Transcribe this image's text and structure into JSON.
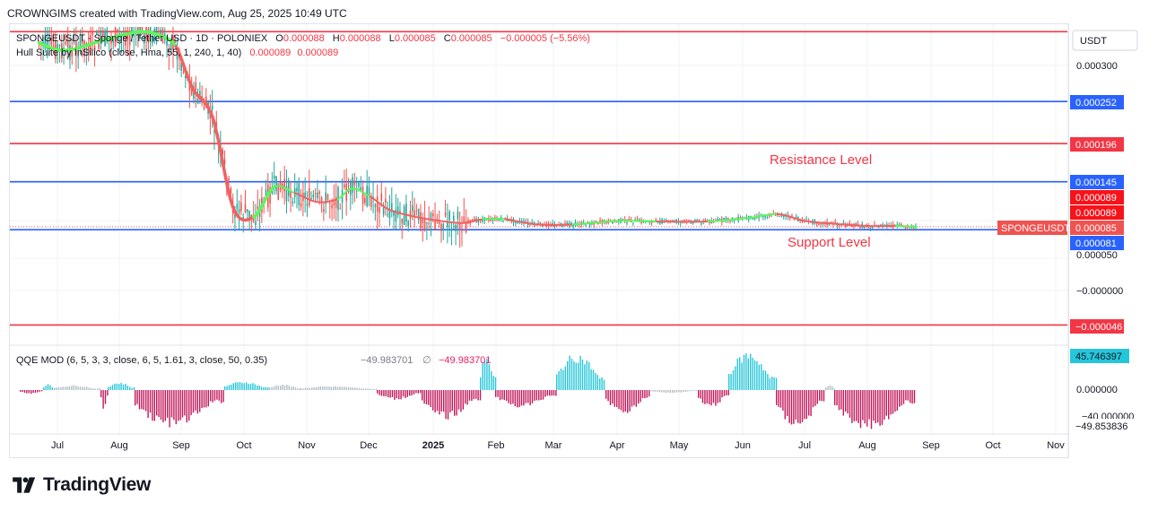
{
  "header": {
    "text": "CROWNGIMS created with TradingView.com, Aug 25, 2025 10:49 UTC"
  },
  "legend": {
    "symbol_line": "SPONGEUSDT · Sponge / Tether USD · 1D · POLONIEX",
    "o_label": "O",
    "o_value": "0.000088",
    "h_label": "H",
    "h_value": "0.000088",
    "l_label": "L",
    "l_value": "0.000085",
    "c_label": "C",
    "c_value": "0.000085",
    "change": "−0.000005 (−5.56%)",
    "hull_label": "Hull Suite by InSilico (close, Hma, 55, 1, 240, 1, 40)",
    "hull_v1": "0.000089",
    "hull_v2": "0.000089",
    "qqe_label": "QQE MOD (6, 5, 3, 3, close, 6, 5, 1.61, 3, close, 50, 0.35)",
    "qqe_v1": "−49.983701",
    "qqe_null": "∅",
    "qqe_v2": "−49.983701"
  },
  "annotations": {
    "resistance": "Resistance Level",
    "support": "Support Level"
  },
  "price_axis": {
    "currency": "USDT",
    "ticks": [
      "0.000300",
      "0.000050",
      "−0.000000"
    ]
  },
  "price_tags": [
    {
      "value": "0.000252",
      "color": "#2962ff"
    },
    {
      "value": "0.000196",
      "color": "#f23645"
    },
    {
      "value": "0.000145",
      "color": "#2962ff"
    },
    {
      "value": "0.000089",
      "color": "#f7131b"
    },
    {
      "value": "0.000089",
      "color": "#f7131b"
    },
    {
      "value": "0.000085",
      "color": "#ef5350"
    },
    {
      "value": "0.000081",
      "color": "#2962ff"
    },
    {
      "value": "−0.000046",
      "color": "#f23645"
    }
  ],
  "symbol_tag": "SPONGEUSDT",
  "qqe_axis": {
    "ticks": [
      "0.000000",
      "−40.000000"
    ],
    "tags": [
      {
        "value": "45.746397",
        "color": "#26c6da"
      },
      {
        "value": "−49.853836",
        "color": "#ffffff"
      }
    ]
  },
  "time_axis": {
    "labels": [
      "Jul",
      "Aug",
      "Sep",
      "Oct",
      "Nov",
      "Dec",
      "2025",
      "Feb",
      "Mar",
      "Apr",
      "May",
      "Jun",
      "Jul",
      "Aug",
      "Sep",
      "Oct",
      "Nov"
    ]
  },
  "brand": {
    "name": "TradingView"
  },
  "chart_data": {
    "type": "candlestick",
    "symbol": "SPONGEUSDT",
    "interval": "1D",
    "exchange": "POLONIEX",
    "ylim": [
      -6e-05,
      0.00036
    ],
    "horizontal_levels": [
      {
        "value": 0.000345,
        "color": "#f23645"
      },
      {
        "value": 0.000252,
        "color": "#2962ff"
      },
      {
        "value": 0.000196,
        "color": "#f23645"
      },
      {
        "value": 0.000145,
        "color": "#2962ff"
      },
      {
        "value": 8.1e-05,
        "color": "#2962ff"
      },
      {
        "value": -4.6e-05,
        "color": "#f23645"
      }
    ],
    "hull_series": {
      "x": [
        "2024-06-22",
        "2024-07-05",
        "2024-07-25",
        "2024-08-10",
        "2024-08-20",
        "2024-08-28",
        "2024-09-05",
        "2024-09-15",
        "2024-09-25",
        "2024-10-05",
        "2024-10-15",
        "2024-10-25",
        "2024-11-05",
        "2024-11-15",
        "2024-11-22",
        "2024-12-01",
        "2024-12-10",
        "2024-12-20",
        "2025-01-01",
        "2025-01-15",
        "2025-01-25",
        "2025-02-05",
        "2025-02-20",
        "2025-03-10",
        "2025-04-01",
        "2025-04-20",
        "2025-05-15",
        "2025-06-05",
        "2025-06-18",
        "2025-07-01",
        "2025-07-15",
        "2025-08-01",
        "2025-08-15",
        "2025-08-25"
      ],
      "y": [
        0.00033,
        0.00032,
        0.000335,
        0.000345,
        0.00034,
        0.000325,
        0.00027,
        0.00023,
        0.00011,
        9.8e-05,
        0.000138,
        0.00013,
        0.000118,
        0.000122,
        0.000136,
        0.000125,
        0.000108,
        0.0001,
        9.4e-05,
        9e-05,
        9.5e-05,
        9.5e-05,
        8.8e-05,
        8.8e-05,
        9.3e-05,
        9.2e-05,
        9.2e-05,
        9.7e-05,
        0.000102,
        9.3e-05,
        8.9e-05,
        8.6e-05,
        8.6e-05,
        8.5e-05
      ],
      "trend": [
        "up",
        "up",
        "up",
        "up",
        "up",
        "down",
        "down",
        "down",
        "down",
        "up",
        "up",
        "down",
        "down",
        "up",
        "up",
        "down",
        "down",
        "down",
        "down",
        "down",
        "up",
        "down",
        "down",
        "up",
        "up",
        "down",
        "up",
        "up",
        "down",
        "down",
        "down",
        "down",
        "up",
        "up"
      ]
    }
  }
}
